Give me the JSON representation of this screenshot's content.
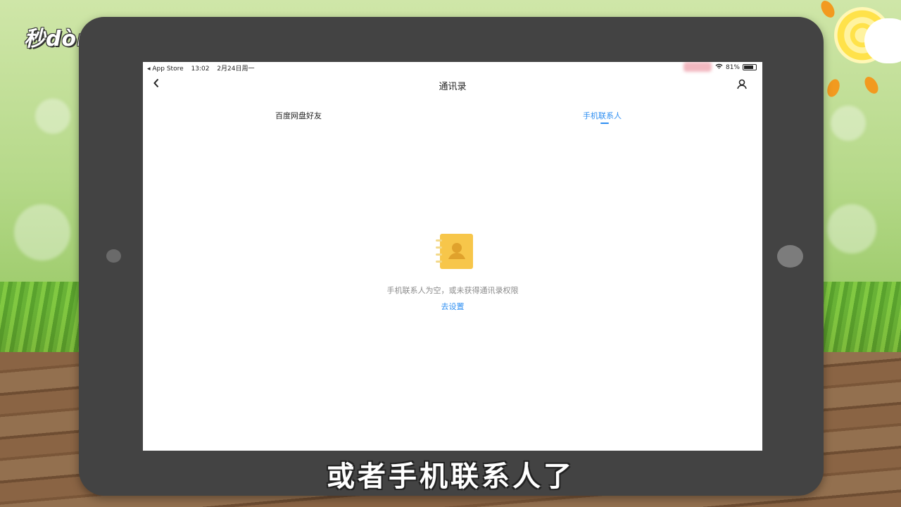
{
  "watermark": {
    "logo_text": "秒dòng经验"
  },
  "status_bar": {
    "back_app": "◂ App Store",
    "time": "13:02",
    "date": "2月24日周一",
    "battery": "81%"
  },
  "nav": {
    "title": "通讯录",
    "back_icon": "chevron-left-icon",
    "right_icon": "user-icon"
  },
  "tabs": [
    {
      "label": "百度网盘好友",
      "active": false
    },
    {
      "label": "手机联系人",
      "active": true
    }
  ],
  "empty_state": {
    "message": "手机联系人为空，或未获得通讯录权限",
    "action": "去设置",
    "icon": "contact-book-icon"
  },
  "subtitle": "或者手机联系人了",
  "colors": {
    "accent": "#2f8ff2",
    "icon_yellow": "#f7c64a",
    "tablet_frame": "#434343"
  }
}
